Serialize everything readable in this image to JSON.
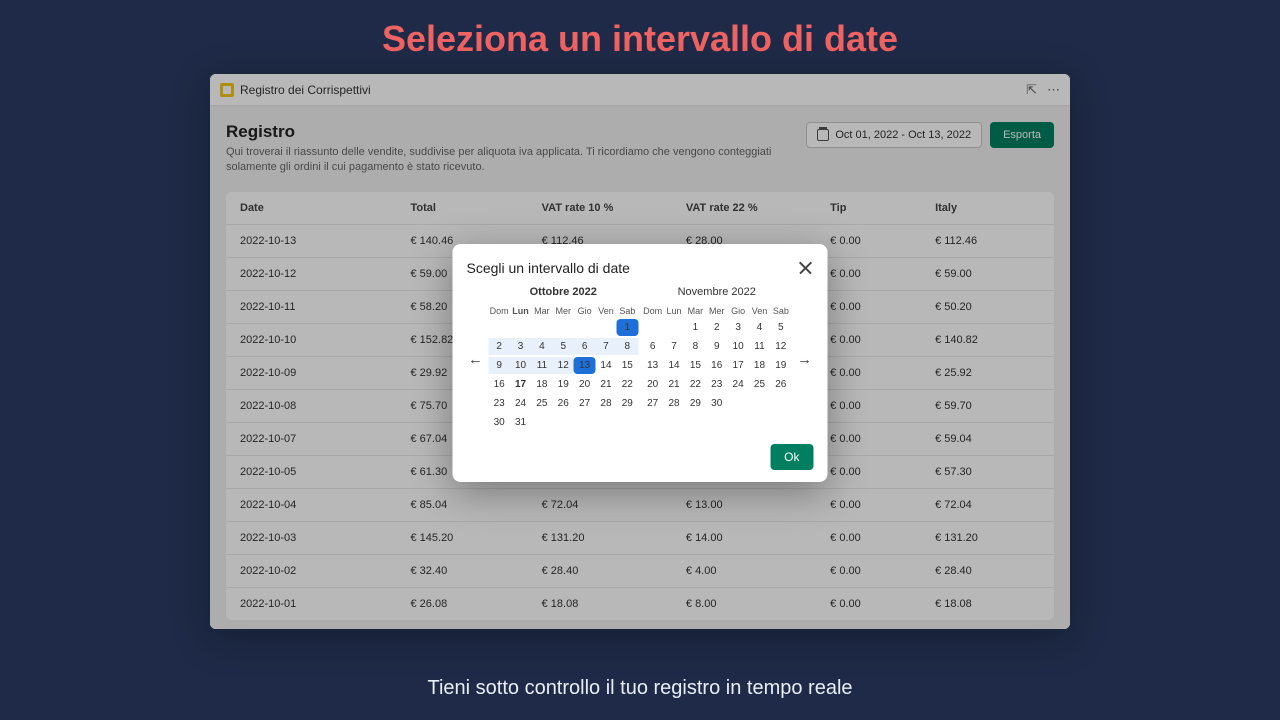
{
  "marketing": {
    "title": "Seleziona un intervallo di date",
    "subtitle": "Tieni sotto controllo il tuo registro in tempo reale"
  },
  "window": {
    "title": "Registro dei Corrispettivi"
  },
  "header": {
    "title": "Registro",
    "desc": "Qui troverai il riassunto delle vendite, suddivise per aliquota iva applicata. Ti ricordiamo che vengono conteggiati solamente gli ordini il cui pagamento è stato ricevuto.",
    "date_range": "Oct 01, 2022 - Oct 13, 2022",
    "export": "Esporta"
  },
  "table": {
    "columns": [
      "Date",
      "Total",
      "VAT rate 10 %",
      "VAT rate 22 %",
      "Tip",
      "Italy"
    ],
    "rows": [
      [
        "2022-10-13",
        "€ 140.46",
        "€ 112.46",
        "€ 28.00",
        "€ 0.00",
        "€ 112.46"
      ],
      [
        "2022-10-12",
        "€ 59.00",
        "",
        "",
        "€ 0.00",
        "€ 59.00"
      ],
      [
        "2022-10-11",
        "€ 58.20",
        "",
        "",
        "€ 0.00",
        "€ 50.20"
      ],
      [
        "2022-10-10",
        "€ 152.82",
        "",
        "",
        "€ 0.00",
        "€ 140.82"
      ],
      [
        "2022-10-09",
        "€ 29.92",
        "",
        "",
        "€ 0.00",
        "€ 25.92"
      ],
      [
        "2022-10-08",
        "€ 75.70",
        "",
        "",
        "€ 0.00",
        "€ 59.70"
      ],
      [
        "2022-10-07",
        "€ 67.04",
        "",
        "",
        "€ 0.00",
        "€ 59.04"
      ],
      [
        "2022-10-05",
        "€ 61.30",
        "",
        "",
        "€ 0.00",
        "€ 57.30"
      ],
      [
        "2022-10-04",
        "€ 85.04",
        "€ 72.04",
        "€ 13.00",
        "€ 0.00",
        "€ 72.04"
      ],
      [
        "2022-10-03",
        "€ 145.20",
        "€ 131.20",
        "€ 14.00",
        "€ 0.00",
        "€ 131.20"
      ],
      [
        "2022-10-02",
        "€ 32.40",
        "€ 28.40",
        "€ 4.00",
        "€ 0.00",
        "€ 28.40"
      ],
      [
        "2022-10-01",
        "€ 26.08",
        "€ 18.08",
        "€ 8.00",
        "€ 0.00",
        "€ 18.08"
      ]
    ]
  },
  "modal": {
    "title": "Scegli un intervallo di date",
    "ok": "Ok",
    "dow": [
      "Dom",
      "Lun",
      "Mar",
      "Mer",
      "Gio",
      "Ven",
      "Sab"
    ],
    "months": [
      {
        "label": "Ottobre 2022",
        "lead_blank": 6,
        "days": 31,
        "today": 17,
        "range_start": 1,
        "range_end": 13
      },
      {
        "label": "Novembre 2022",
        "lead_blank": 2,
        "days": 30,
        "today": null,
        "range_start": null,
        "range_end": null
      }
    ]
  }
}
